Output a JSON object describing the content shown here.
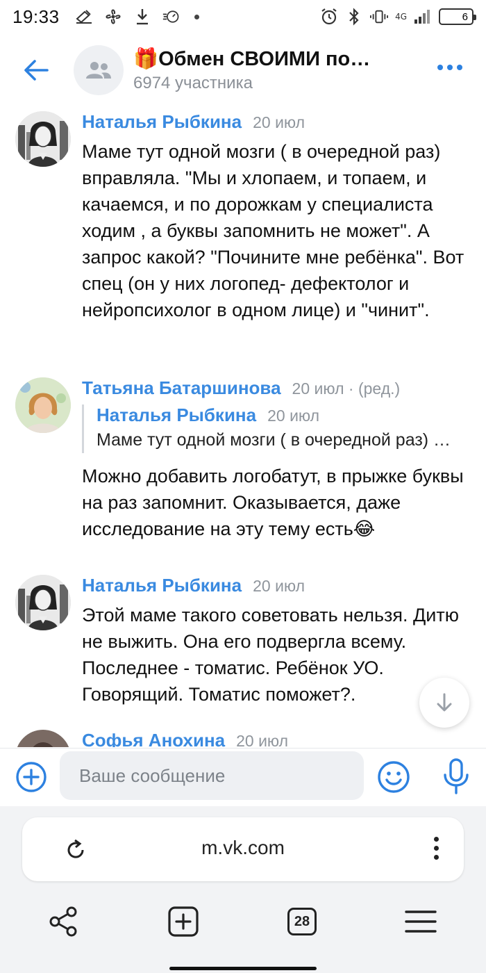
{
  "status": {
    "time": "19:33",
    "network": "4G",
    "battery": "6"
  },
  "header": {
    "back_icon": "arrow-left-icon",
    "group_icon": "group-icon",
    "title": "🎁Обмен СВОИМИ по…",
    "subtitle": "6974 участника",
    "menu_icon": "more-dots-icon"
  },
  "messages": [
    {
      "author": "Наталья Рыбкина",
      "date": "20 июл",
      "text": "Маме тут одной мозги ( в очередной раз) вправляла. \"Мы и хлопаем, и топаем, и качаемся, и по дорожкам у специалиста ходим , а буквы запомнить не может\". А запрос какой? \"Почините мне ребёнка\". Вот спец (он у них логопед- дефектолог и нейропсихолог в одном лице) и \"чинит\"."
    },
    {
      "author": "Татьяна Батаршинова",
      "date": "20 июл · (ред.)",
      "reply": {
        "author": "Наталья Рыбкина",
        "date": "20 июл",
        "text": "Маме тут одной мозги ( в очередной раз) вправляла."
      },
      "text": "Можно добавить логобатут, в прыжке буквы на раз запомнит. Оказывается, даже исследование на эту тему есть😂"
    },
    {
      "author": "Наталья Рыбкина",
      "date": "20 июл",
      "text": "Этой маме такого советовать нельзя. Дитю не выжить. Она его подвергла всему. Последнее - томатис. Ребёнок УО. Говорящий. Томатис поможет?."
    },
    {
      "author": "Софья Анохина",
      "date": "20 июл",
      "text": ""
    }
  ],
  "composer": {
    "placeholder": "Ваше сообщение",
    "attach_icon": "plus-circle-icon",
    "emoji_icon": "smile-icon",
    "mic_icon": "microphone-icon"
  },
  "browser": {
    "url": "m.vk.com",
    "tabs_count": "28",
    "reload_icon": "reload-icon",
    "share_icon": "share-icon",
    "new_tab_icon": "new-tab-icon",
    "menu_icon": "hamburger-icon"
  },
  "colors": {
    "accent": "#2d81e0",
    "name": "#3a8ae0",
    "muted": "#8a8f96"
  }
}
